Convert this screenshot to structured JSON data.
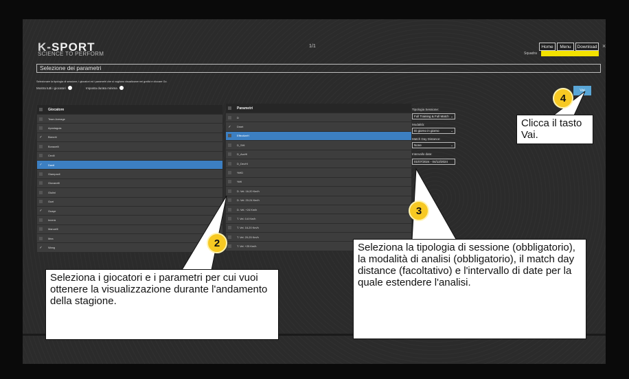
{
  "header": {
    "logo_mark": "K-",
    "logo_text": "SPORT",
    "tagline": "SCIENCE TO PERFORM",
    "page_indicator": "1/1",
    "buttons": [
      "Home",
      "Menu",
      "Download"
    ],
    "squadra_label": "Squadra",
    "close_glyph": "×"
  },
  "section_title": "Selezione dei parametri",
  "instructions": "Selezionare la tipologia di sessione, i giocatori ed i parametri che si vogliono visualizzare nei grafici e cliccare Go.",
  "toggles": [
    {
      "label": "Mostra tutti i giocatori"
    },
    {
      "label": "Imposta durata minima"
    }
  ],
  "vai_label": "Vai",
  "players": {
    "header": "Giocatore",
    "rows": [
      {
        "name": "Team Average",
        "checked": false,
        "selected": false
      },
      {
        "name": "Apostaguia",
        "checked": false,
        "selected": false
      },
      {
        "name": "Bianchi",
        "checked": true,
        "selected": false
      },
      {
        "name": "Bonacelli",
        "checked": false,
        "selected": false
      },
      {
        "name": "Cecili",
        "checked": false,
        "selected": false
      },
      {
        "name": "Dardi",
        "checked": true,
        "selected": true
      },
      {
        "name": "Giampaoli",
        "checked": false,
        "selected": false
      },
      {
        "name": "Giovanelli",
        "checked": false,
        "selected": false
      },
      {
        "name": "Giulini",
        "checked": false,
        "selected": false
      },
      {
        "name": "Guei",
        "checked": false,
        "selected": false
      },
      {
        "name": "Guaye",
        "checked": true,
        "selected": false
      },
      {
        "name": "Innerà",
        "checked": false,
        "selected": false
      },
      {
        "name": "Manuelli",
        "checked": false,
        "selected": false
      },
      {
        "name": "Mea",
        "checked": false,
        "selected": false
      },
      {
        "name": "Wang",
        "checked": true,
        "selected": false
      }
    ]
  },
  "parameters": {
    "header": "Parametri",
    "rows": [
      {
        "name": "D",
        "checked": false,
        "selected": false
      },
      {
        "name": "Dmet",
        "checked": true,
        "selected": false
      },
      {
        "name": "EffectiveH",
        "checked": false,
        "selected": true
      },
      {
        "name": "D_SHI",
        "checked": false,
        "selected": false
      },
      {
        "name": "D_AccHI",
        "checked": false,
        "selected": false
      },
      {
        "name": "D_DecHI",
        "checked": false,
        "selected": false
      },
      {
        "name": "%HD",
        "checked": false,
        "selected": false
      },
      {
        "name": "%HI",
        "checked": false,
        "selected": false
      },
      {
        "name": "D. Vel. 16-20 Km/h",
        "checked": false,
        "selected": false
      },
      {
        "name": "D. Vel. 20-24 Km/h",
        "checked": false,
        "selected": false
      },
      {
        "name": "D. Vel. +24 Km/h",
        "checked": false,
        "selected": false
      },
      {
        "name": "T. Vel. 0-6 Km/h",
        "checked": false,
        "selected": false
      },
      {
        "name": "T. Vel. 16-20 Km/h",
        "checked": false,
        "selected": false
      },
      {
        "name": "T. Vel. 20-25 Km/h",
        "checked": false,
        "selected": false
      },
      {
        "name": "T. Vel. +25 Km/h",
        "checked": false,
        "selected": false
      }
    ]
  },
  "filters": {
    "session_label": "Tipologia Sessione:",
    "session_value": "Full Training & Full Match",
    "mode_label": "Modalità:",
    "mode_value": "Di giorno in giorno",
    "mdd_label": "Match Day Distance:",
    "mdd_value": "None",
    "date_label": "Intervallo date:",
    "date_value": "01/07/2024 - 04/12/2024"
  },
  "callouts": {
    "c2": {
      "num": "2",
      "text": "Seleziona i giocatori e i parametri per cui vuoi ottenere la visualizzazione durante l'andamento della stagione."
    },
    "c3": {
      "num": "3",
      "text": "Seleziona la tipologia di sessione (obbligatorio), la modalità di analisi (obbligatorio), il match day distance (facoltativo) e l'intervallo di date per la quale estendere l'analisi."
    },
    "c4": {
      "num": "4",
      "text": "Clicca il tasto Vai."
    }
  },
  "colors": {
    "accent": "#3c7fc2",
    "badge": "#f7c923",
    "squadra": "#f3e200",
    "vai": "#5aa6d6"
  }
}
